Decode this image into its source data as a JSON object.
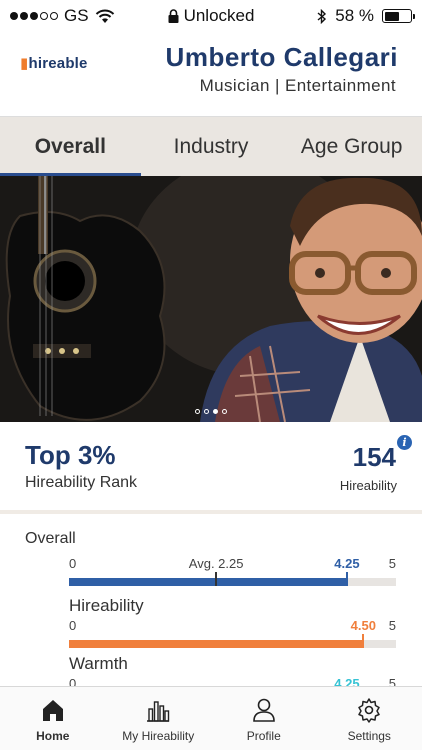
{
  "status_bar": {
    "carrier": "GS",
    "lock_status": "Unlocked",
    "battery_percent": "58 %",
    "battery_level": 0.58
  },
  "header": {
    "logo_text": "hireable",
    "user_name": "Umberto Callegari",
    "user_role": "Musician | Entertainment"
  },
  "tabs": [
    {
      "label": "Overall",
      "active": true
    },
    {
      "label": "Industry",
      "active": false
    },
    {
      "label": "Age Group",
      "active": false
    }
  ],
  "hero": {
    "pager_total": 4,
    "pager_active": 3
  },
  "rank": {
    "rank_value": "Top 3%",
    "rank_label": "Hireability Rank",
    "score_value": "154",
    "score_label": "Hireability",
    "info_icon": "i"
  },
  "metrics": {
    "heading": "Overall",
    "overall_bar": {
      "min": "0",
      "max": "5",
      "value": "4.25",
      "value_num": 4.25,
      "avg_label": "Avg. 2.25",
      "avg_num": 2.25,
      "color": "#2f5fa6"
    },
    "items": [
      {
        "title": "Hireability",
        "min": "0",
        "max": "5",
        "value": "4.50",
        "value_num": 4.5,
        "color": "#f07f3c"
      },
      {
        "title": "Warmth",
        "min": "0",
        "max": "5",
        "value": "4.25",
        "value_num": 4.25,
        "color": "#36c3d4"
      }
    ]
  },
  "bottom_nav": [
    {
      "label": "Home",
      "icon": "home-icon",
      "active": true
    },
    {
      "label": "My Hireability",
      "icon": "bar-chart-icon",
      "active": false
    },
    {
      "label": "Profile",
      "icon": "person-icon",
      "active": false
    },
    {
      "label": "Settings",
      "icon": "gear-icon",
      "active": false
    }
  ],
  "colors": {
    "brand_navy": "#1f3a6b",
    "brand_orange": "#ef7d2d",
    "tab_bg": "#eae6e1"
  }
}
